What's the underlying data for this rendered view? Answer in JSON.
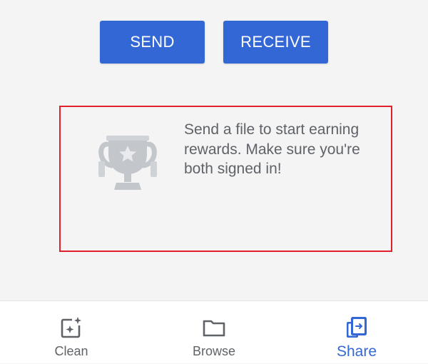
{
  "actions": {
    "send_label": "SEND",
    "receive_label": "RECEIVE"
  },
  "rewards": {
    "icon": "trophy-icon",
    "message": "Send a file to start earning rewards. Make sure you're both signed in!"
  },
  "bottom_nav": {
    "items": [
      {
        "label": "Clean",
        "icon": "clean-icon",
        "active": false
      },
      {
        "label": "Browse",
        "icon": "folder-icon",
        "active": false
      },
      {
        "label": "Share",
        "icon": "share-icon",
        "active": true
      }
    ]
  },
  "colors": {
    "accent": "#3367d6",
    "background": "#f4f4f4",
    "text_secondary": "#5f6368",
    "highlight": "#e0202a"
  }
}
